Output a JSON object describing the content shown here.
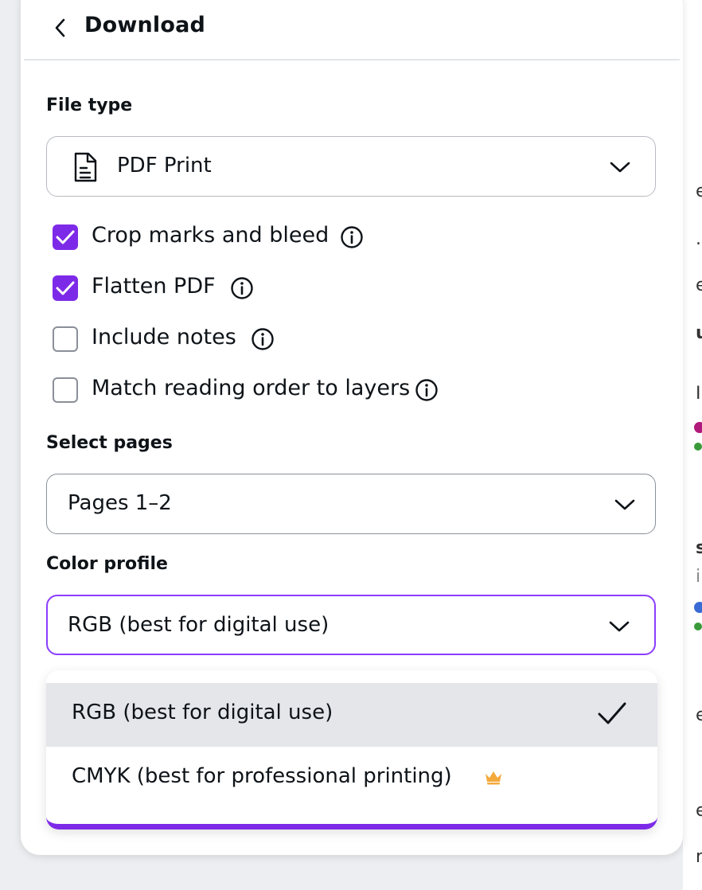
{
  "header": {
    "title": "Download"
  },
  "file_type": {
    "label": "File type",
    "selected": "PDF Print"
  },
  "options": [
    {
      "label": "Crop marks and bleed",
      "checked": true
    },
    {
      "label": "Flatten PDF",
      "checked": true
    },
    {
      "label": "Include notes",
      "checked": false
    },
    {
      "label": "Match reading order to layers",
      "checked": false
    }
  ],
  "pages": {
    "label": "Select pages",
    "selected": "Pages 1–2"
  },
  "color_profile": {
    "label": "Color profile",
    "selected": "RGB (best for digital use)",
    "menu": [
      {
        "label": "RGB (best for digital use)",
        "selected": true
      },
      {
        "label": "CMYK (best for professional printing)",
        "premium": true
      }
    ]
  },
  "colors": {
    "accent": "#8b3dff",
    "checkbox": "#7d2ae8",
    "crown": "#f4a93b"
  }
}
